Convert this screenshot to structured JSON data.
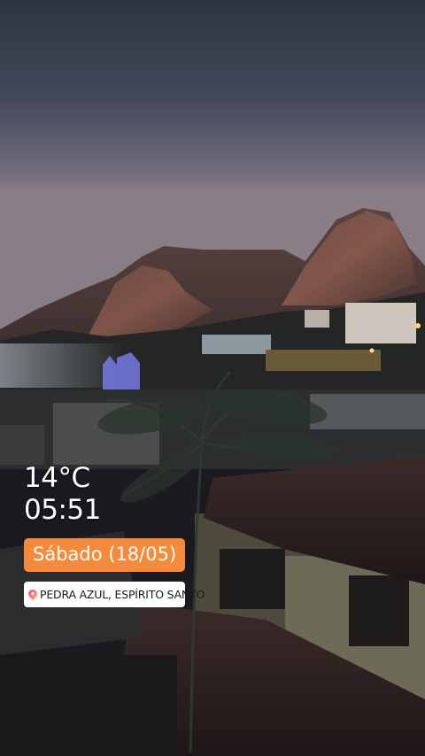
{
  "story": {
    "temperature": "14°C",
    "time": "05:51",
    "day_label": "Sábado (18/05)",
    "location_label": "PEDRA AZUL, ESPÍRITO SANTO",
    "location_icon": "map-pin-icon"
  },
  "colors": {
    "day_sticker_bg": "#f58b3a",
    "location_sticker_bg": "#ffffff",
    "pin_gradient": [
      "#ff3ea5",
      "#ffb03a"
    ]
  }
}
